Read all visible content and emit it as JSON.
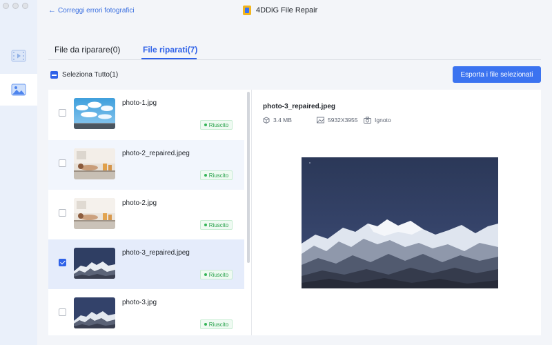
{
  "app": {
    "title": "4DDiG File Repair",
    "back_label": "Correggi errori fotografici"
  },
  "sidebar": {
    "items": [
      {
        "icon": "video-icon",
        "active": false
      },
      {
        "icon": "photo-icon",
        "active": true
      }
    ]
  },
  "tabs": [
    {
      "label": "File da riparare(0)",
      "active": false
    },
    {
      "label": "File riparati(7)",
      "active": true
    }
  ],
  "select_all": {
    "label": "Seleziona Tutto(1)",
    "state": "partial"
  },
  "export_button": {
    "label": "Esporta i file selezionati"
  },
  "files": [
    {
      "name": "photo-1.jpg",
      "status": "Riuscito",
      "checked": false,
      "thumb": "clouds"
    },
    {
      "name": "photo-2_repaired.jpeg",
      "status": "Riuscito",
      "checked": false,
      "thumb": "spa"
    },
    {
      "name": "photo-2.jpg",
      "status": "Riuscito",
      "checked": false,
      "thumb": "spa"
    },
    {
      "name": "photo-3_repaired.jpeg",
      "status": "Riuscito",
      "checked": true,
      "thumb": "mountain"
    },
    {
      "name": "photo-3.jpg",
      "status": "Riuscito",
      "checked": false,
      "thumb": "mountain"
    }
  ],
  "detail": {
    "title": "photo-3_repaired.jpeg",
    "size": "3.4 MB",
    "dimensions": "5932X3955",
    "camera": "Ignoto"
  },
  "colors": {
    "accent": "#2f62e8",
    "success": "#27a24a",
    "selected_row": "#e5ecfb"
  }
}
